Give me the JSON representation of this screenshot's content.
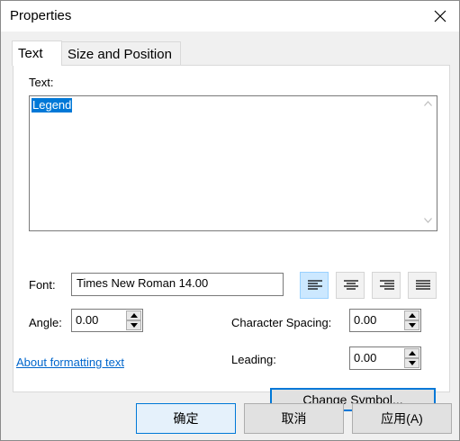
{
  "window": {
    "title": "Properties"
  },
  "tabs": [
    {
      "label": "Text",
      "active": true
    },
    {
      "label": "Size and Position",
      "active": false
    }
  ],
  "text_panel": {
    "text_label": "Text:",
    "text_value": "Legend",
    "font_label": "Font:",
    "font_value": "Times New Roman 14.00",
    "angle_label": "Angle:",
    "angle_value": "0.00",
    "char_spacing_label": "Character Spacing:",
    "char_spacing_value": "0.00",
    "leading_label": "Leading:",
    "leading_value": "0.00",
    "alignment_options": [
      "left",
      "center",
      "right",
      "justify"
    ],
    "alignment_selected": "left",
    "about_link": "About formatting text",
    "change_symbol_label": "Change Symbol..."
  },
  "footer": {
    "ok_label": "确定",
    "cancel_label": "取消",
    "apply_label": "应用(A)"
  },
  "colors": {
    "selection": "#0078d7",
    "link": "#0066cc",
    "selected_align_bg": "#cce8ff"
  }
}
